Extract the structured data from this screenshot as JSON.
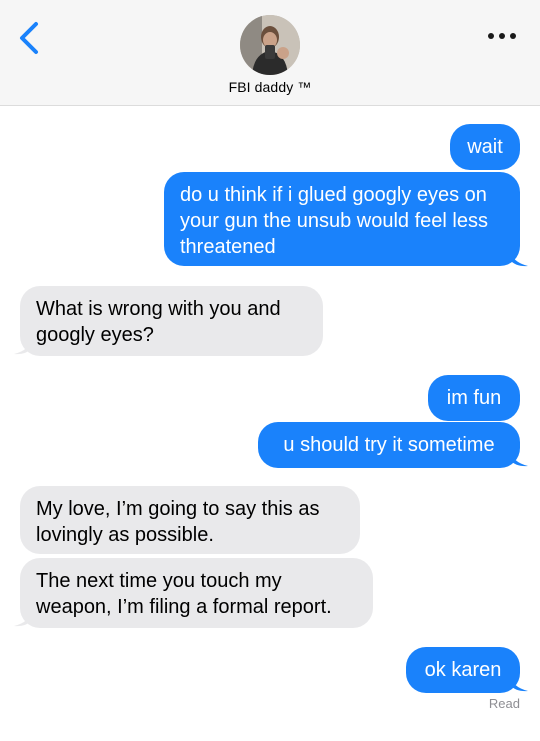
{
  "contact": {
    "name": "FBI daddy ™"
  },
  "icons": {
    "back": "chevron-left-icon",
    "more": "ellipsis-icon"
  },
  "colors": {
    "outgoing": "#1a82fb",
    "incoming": "#e9e9eb",
    "accent": "#1a82fb"
  },
  "messages": [
    {
      "sender": "me",
      "text": "wait"
    },
    {
      "sender": "me",
      "text": "do u think if i glued googly eyes on your gun the unsub would feel less threatened"
    },
    {
      "sender": "them",
      "text": "What is wrong with you and googly eyes?"
    },
    {
      "sender": "me",
      "text": "im fun"
    },
    {
      "sender": "me",
      "text": "u should try it sometime"
    },
    {
      "sender": "them",
      "text": "My love, I’m going to say this as lovingly as possible."
    },
    {
      "sender": "them",
      "text": "The next time you touch my weapon, I’m filing a formal report."
    },
    {
      "sender": "me",
      "text": "ok karen"
    }
  ],
  "status": {
    "read": "Read"
  }
}
